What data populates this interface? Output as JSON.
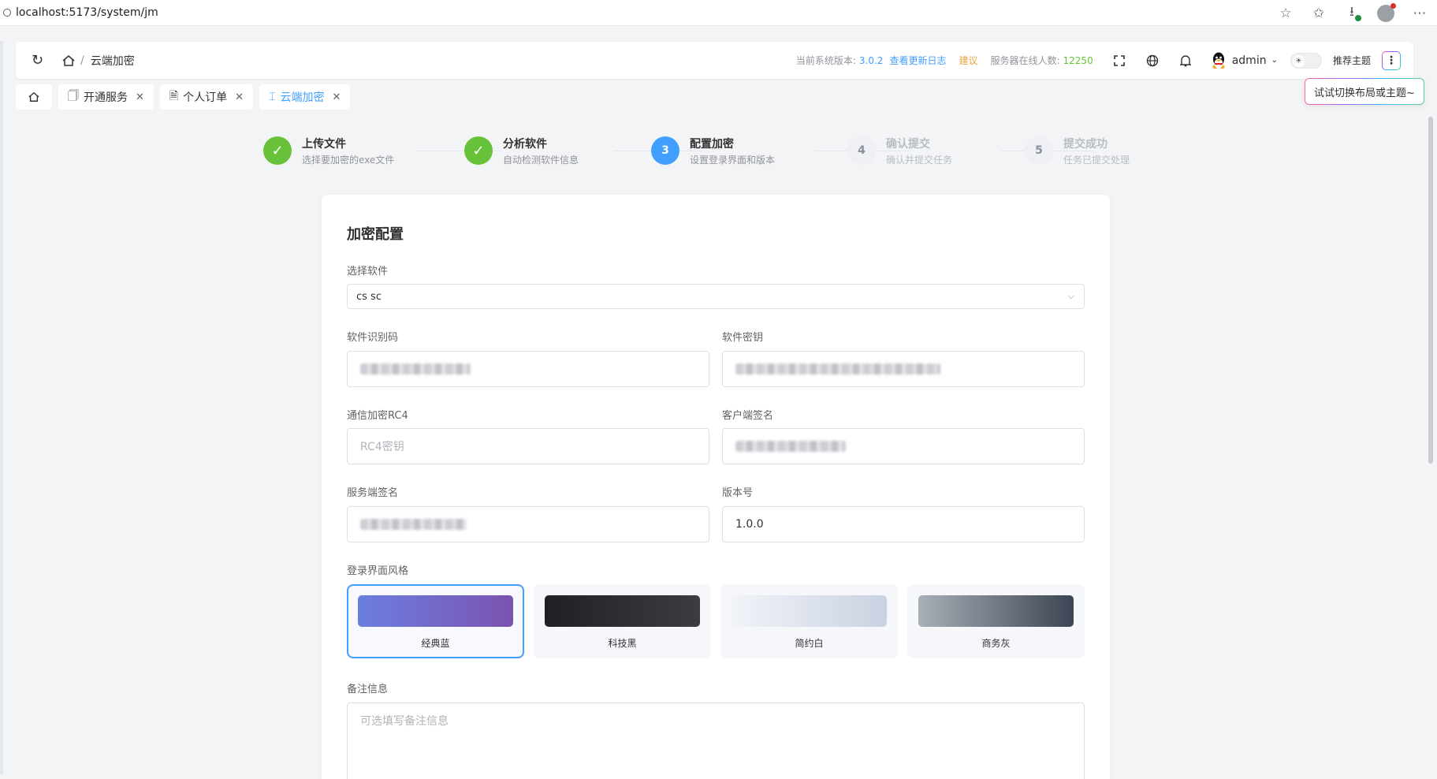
{
  "browser": {
    "url": "localhost:5173/system/jm"
  },
  "header": {
    "breadcrumb_current": "云端加密",
    "version_label": "当前系统版本:",
    "version": "3.0.2",
    "changelog_link": "查看更新日志",
    "suggest_link": "建议",
    "online_label": "服务器在线人数:",
    "online_count": "12250",
    "username": "admin",
    "recommend_theme": "推荐主题",
    "tooltip": "试试切换布局或主题~"
  },
  "tabs": [
    {
      "label": "开通服务"
    },
    {
      "label": "个人订单"
    },
    {
      "label": "云端加密"
    }
  ],
  "steps": [
    {
      "number": "✓",
      "title": "上传文件",
      "desc": "选择要加密的exe文件",
      "status": "done"
    },
    {
      "number": "✓",
      "title": "分析软件",
      "desc": "自动检测软件信息",
      "status": "done"
    },
    {
      "number": "3",
      "title": "配置加密",
      "desc": "设置登录界面和版本",
      "status": "active"
    },
    {
      "number": "4",
      "title": "确认提交",
      "desc": "确认并提交任务",
      "status": "wait"
    },
    {
      "number": "5",
      "title": "提交成功",
      "desc": "任务已提交处理",
      "status": "wait"
    }
  ],
  "form": {
    "title": "加密配置",
    "software_label": "选择软件",
    "software_value": "cs sc",
    "software_id_label": "软件识别码",
    "software_key_label": "软件密钥",
    "rc4_label": "通信加密RC4",
    "rc4_placeholder": "RC4密钥",
    "client_sign_label": "客户端签名",
    "server_sign_label": "服务端签名",
    "version_label": "版本号",
    "version_value": "1.0.0",
    "style_label": "登录界面风格",
    "styles": [
      {
        "name": "经典蓝",
        "colors": [
          "#6b7fe0",
          "#7b52b0"
        ],
        "selected": true
      },
      {
        "name": "科技黑",
        "colors": [
          "#1f2025",
          "#3c3d42"
        ],
        "selected": false
      },
      {
        "name": "简约白",
        "colors": [
          "#f1f3f8",
          "#c9d2e2"
        ],
        "selected": false
      },
      {
        "name": "商务灰",
        "colors": [
          "#a9afb7",
          "#3c4553"
        ],
        "selected": false
      }
    ],
    "remark_label": "备注信息",
    "remark_placeholder": "可选填写备注信息"
  },
  "colors": {
    "primary": "#409eff",
    "success": "#67c23a",
    "warning": "#e6a23c"
  }
}
